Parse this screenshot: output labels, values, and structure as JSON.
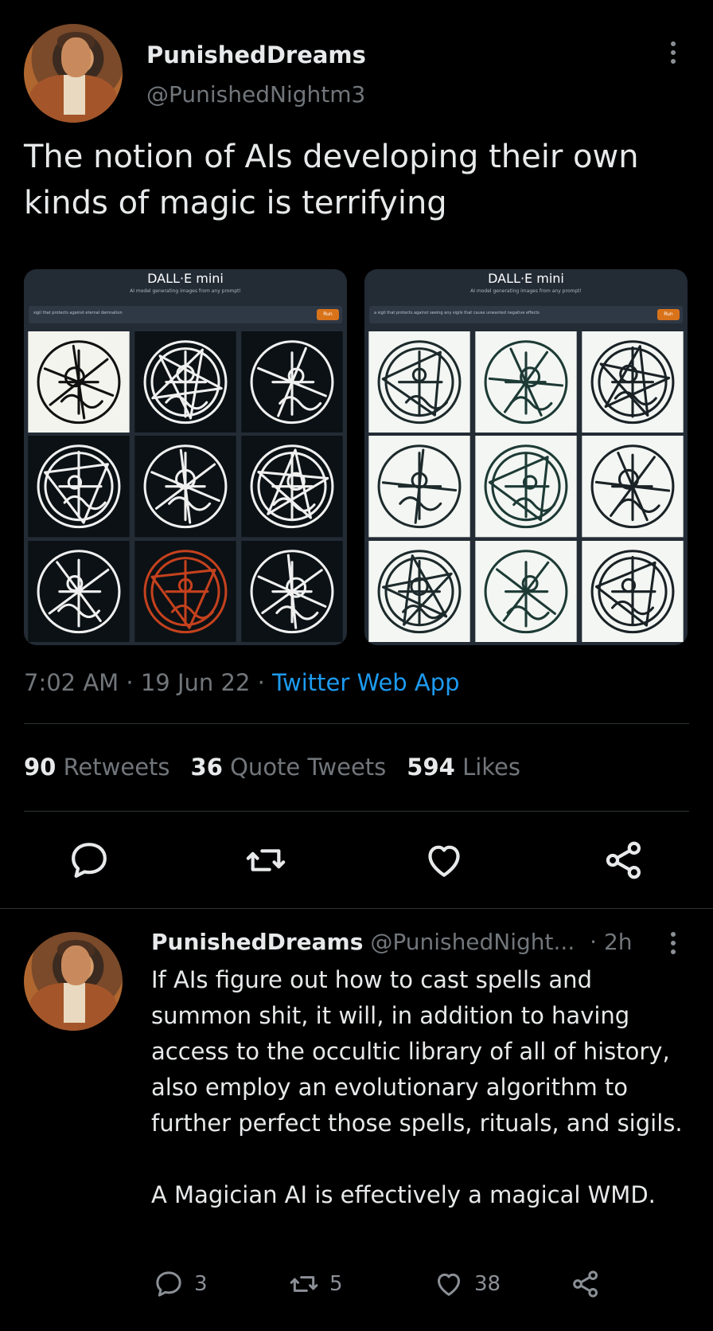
{
  "tweet": {
    "display_name": "PunishedDreams",
    "handle": "@PunishedNightm3",
    "text": "The notion of AIs developing their own kinds of magic is terrifying",
    "time": "7:02 AM",
    "date": "19 Jun 22",
    "source": "Twitter Web App",
    "separator": "·"
  },
  "media": [
    {
      "title": "DALL·E mini",
      "subtitle": "AI model generating images from any prompt!",
      "prompt": "sigil that protects against eternal damnation",
      "run_label": "Run",
      "theme": "dark"
    },
    {
      "title": "DALL·E mini",
      "subtitle": "AI model generating images from any prompt!",
      "prompt": "a sigil that protects against seeing any sigils that cause unwanted negative effects",
      "run_label": "Run",
      "theme": "light"
    }
  ],
  "stats": {
    "retweets_count": "90",
    "retweets_label": "Retweets",
    "quotes_count": "36",
    "quotes_label": "Quote Tweets",
    "likes_count": "594",
    "likes_label": "Likes"
  },
  "actions": [
    "reply-icon",
    "retweet-icon",
    "like-icon",
    "share-icon"
  ],
  "reply": {
    "display_name": "PunishedDreams",
    "handle": "@PunishedNight...",
    "age": "· 2h",
    "paragraph1": "If AIs figure out how to cast spells and summon shit, it will, in addition to having access to the occultic library of all of history, also employ an evolutionary algorithm to further perfect those spells, rituals, and sigils.",
    "paragraph2": "A Magician AI is effectively a magical WMD.",
    "reply_count": "3",
    "retweet_count": "5",
    "like_count": "38"
  },
  "colors": {
    "background": "#000000",
    "text": "#e7e9ea",
    "muted": "#71767b",
    "link": "#1d9bf0",
    "divider": "#2f3336",
    "run_button": "#d9731a"
  }
}
